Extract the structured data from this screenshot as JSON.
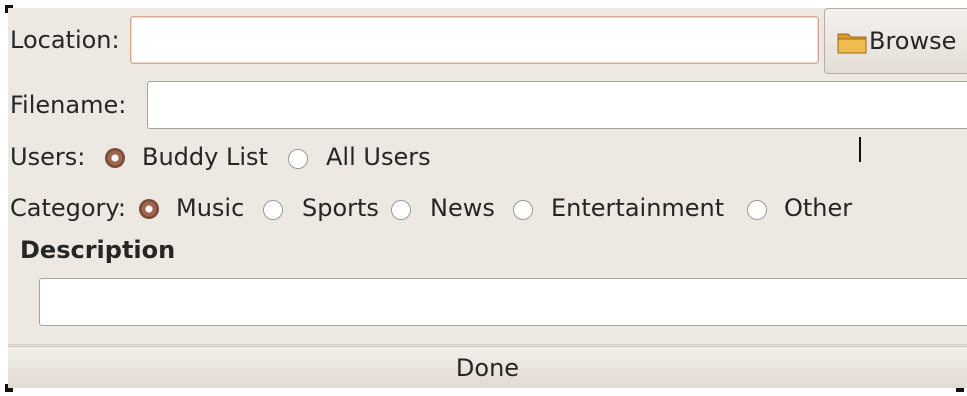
{
  "form": {
    "location": {
      "label": "Location:",
      "value": ""
    },
    "browse_label": "Browse",
    "filename": {
      "label": "Filename:",
      "value": ""
    },
    "users": {
      "label": "Users:",
      "options": [
        "Buddy List",
        "All Users"
      ],
      "selected": "Buddy List"
    },
    "category": {
      "label": "Category:",
      "options": [
        "Music",
        "Sports",
        "News",
        "Entertainment",
        "Other"
      ],
      "selected": "Music"
    },
    "description": {
      "title": "Description",
      "value": ""
    },
    "done_label": "Done"
  },
  "icons": {
    "browse": "folder-icon",
    "radio_selected": "radio-selected-icon",
    "radio_unselected": "radio-unselected-icon"
  },
  "colors": {
    "background": "#ede8e2",
    "radio_selected": "#7a4a3a",
    "focus_border": "#d8aa8d"
  }
}
